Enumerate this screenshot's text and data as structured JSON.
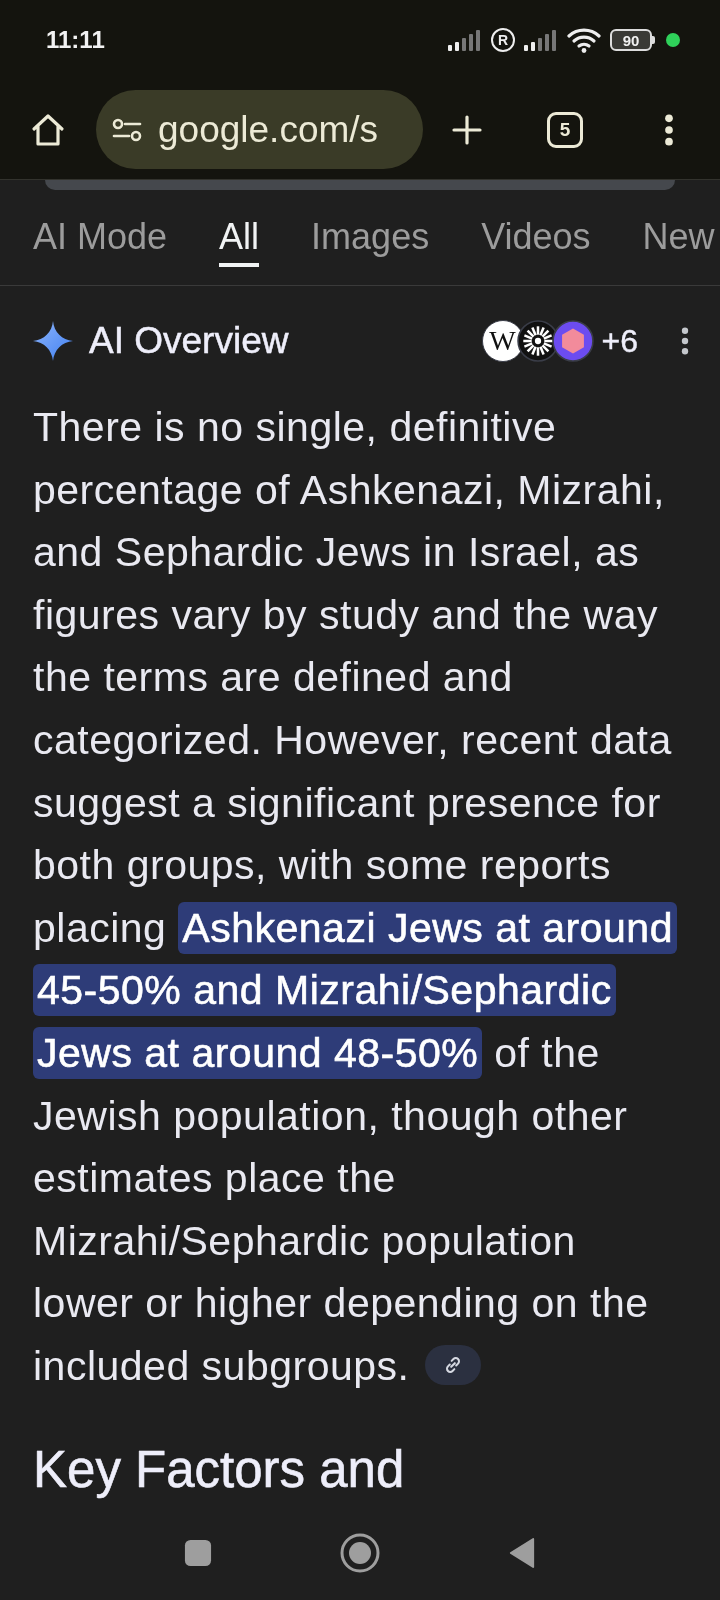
{
  "status_bar": {
    "time": "11:11",
    "roaming_badge": "R",
    "battery": "90"
  },
  "toolbar": {
    "url": "google.com/s",
    "tab_count": "5"
  },
  "tabs": [
    {
      "label": "AI Mode",
      "selected": false
    },
    {
      "label": "All",
      "selected": true
    },
    {
      "label": "Images",
      "selected": false
    },
    {
      "label": "Videos",
      "selected": false
    },
    {
      "label": "New",
      "selected": false
    }
  ],
  "ai_overview": {
    "title": "AI Overview",
    "sources": [
      {
        "kind": "letter",
        "glyph": "W"
      },
      {
        "kind": "burst"
      },
      {
        "kind": "hexagon"
      }
    ],
    "more_sources": "+6",
    "text": "There is no single, definitive percentage of Ashkenazi, Mizrahi, and Sephardic Jews in Israel, as figures vary by study and the way the terms are defined and categorized. However, recent data suggest a significant presence for both groups, with some reports placing **Ashkenazi Jews at around 45-50% and Mizrahi/Sephardic Jews at around 48-50%** of the Jewish population, though other estimates place the Mizrahi/Sephardic population lower or higher depending on the included subgroups."
  },
  "section_heading": "Key Factors and"
}
